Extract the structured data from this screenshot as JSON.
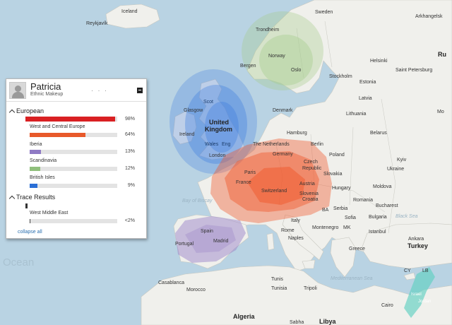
{
  "panel": {
    "name": "Patricia",
    "name_obscured": "· · ·",
    "subtitle": "Ethnic Makeup",
    "sections": [
      {
        "title": "European",
        "percent": "98%",
        "fraction": 0.98,
        "color": "#d92022",
        "rows": [
          {
            "label": "West and Central Europe",
            "percent": "64%",
            "fraction": 0.64,
            "color": "#e8592a"
          },
          {
            "label": "Iberia",
            "percent": "13%",
            "fraction": 0.13,
            "color": "#8f7ac4"
          },
          {
            "label": "Scandinavia",
            "percent": "12%",
            "fraction": 0.12,
            "color": "#90c07c"
          },
          {
            "label": "British Isles",
            "percent": "9%",
            "fraction": 0.09,
            "color": "#2b6fd6"
          }
        ]
      },
      {
        "title": "Trace Results",
        "rows": [
          {
            "label": "West Middle East",
            "percent": "<2%",
            "fraction": 0.01,
            "color": "#444444"
          }
        ]
      }
    ],
    "collapse_label": "collapse all"
  },
  "map": {
    "labels": {
      "iceland": "Iceland",
      "reykjavik": "Reykjavík",
      "sweden": "Sweden",
      "trondheim": "Trondheim",
      "norway": "Norway",
      "bergen": "Bergen",
      "oslo": "Oslo",
      "stockholm": "Stockholm",
      "helsinki": "Helsinki",
      "saint_petersburg": "Saint Petersburg",
      "arkhangelsk": "Arkhangelsk",
      "ru": "Ru",
      "estonia": "Estonia",
      "latvia": "Latvia",
      "lithuania": "Lithuania",
      "belarus": "Belarus",
      "denmark": "Denmark",
      "moscow": "Mo",
      "scotland": "Scot",
      "glasgow": "Glasgow",
      "uk1": "United",
      "uk2": "Kingdom",
      "ireland": "Ireland",
      "wales": "Wales",
      "england": "Eng",
      "london": "London",
      "hamburg": "Hamburg",
      "berlin": "Berlin",
      "netherlands": "The Netherlands",
      "germany": "Germany",
      "poland": "Poland",
      "kyiv": "Kyiv",
      "ukraine": "Ukraine",
      "czech1": "Czech",
      "czech2": "Republic",
      "slovakia": "Slovakia",
      "paris": "Paris",
      "france": "France",
      "austria": "Austria",
      "hungary": "Hungary",
      "moldova": "Moldova",
      "switzerland": "Switzerland",
      "slovenia": "Slovenia",
      "croatia": "Croatia",
      "ba": "BA",
      "serbia": "Serbia",
      "romania": "Romania",
      "bucharest": "Bucharest",
      "bulgaria": "Bulgaria",
      "montenegro": "Montenegro",
      "mk": "MK",
      "sofia": "Sofia",
      "italy": "Italy",
      "rome": "Rome",
      "naples": "Naples",
      "istanbul": "Istanbul",
      "ankara": "Ankara",
      "turkey": "Turkey",
      "greece": "Greece",
      "portugal": "Portugal",
      "spain": "Spain",
      "madrid": "Madrid",
      "casablanca": "Casablanca",
      "morocco": "Morocco",
      "tunis": "Tunis",
      "tunisia": "Tunisia",
      "tripoli": "Tripoli",
      "algeria": "Algeria",
      "sabha": "Sabha",
      "libya": "Libya",
      "cairo": "Cairo",
      "cy": "CY",
      "lb": "LB",
      "israel": "Israel",
      "jordan": "Jordan",
      "ocean": "Ocean",
      "bay": "Bay of Biscay",
      "black_sea": "Black Sea",
      "med_sea": "Mediterranean Sea"
    },
    "regions": {
      "west_central_color": "#f0582c",
      "british_color": "#3d7be0",
      "scandinavia_color": "#a6cc8d",
      "iberia_color": "#9b86c9",
      "middle_east_color": "#5fd0c2",
      "land_color": "#f0f0ec",
      "water_color": "#b9d3e3"
    }
  }
}
